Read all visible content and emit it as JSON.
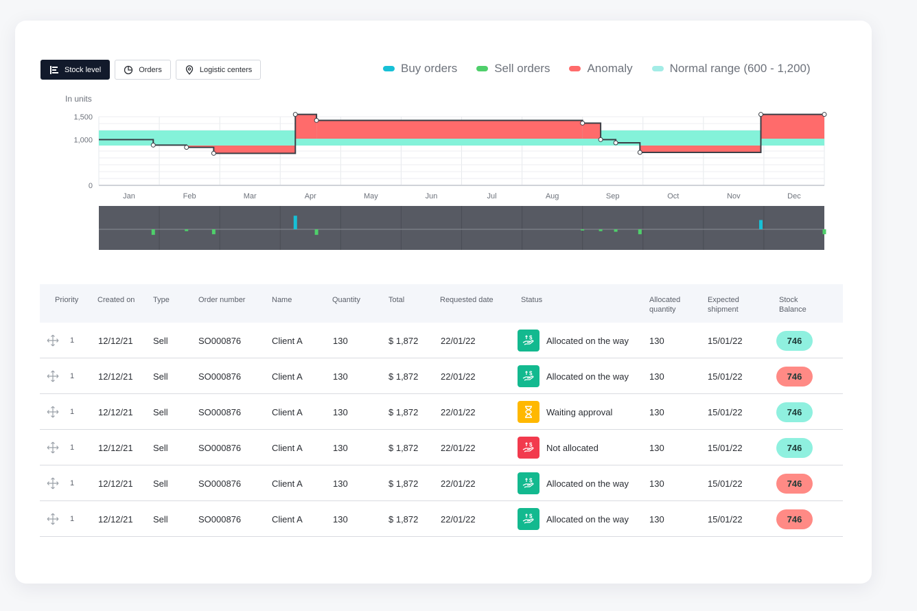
{
  "tabs": [
    {
      "label": "Stock level",
      "icon": "bar-list-icon",
      "active": true
    },
    {
      "label": "Orders",
      "icon": "pie-chart-icon",
      "active": false
    },
    {
      "label": "Logistic centers",
      "icon": "location-pin-icon",
      "active": false
    }
  ],
  "legend": [
    {
      "label": "Buy orders",
      "color": "#17c0d6"
    },
    {
      "label": "Sell orders",
      "color": "#4fcf6b"
    },
    {
      "label": "Anomaly",
      "color": "#ff6b6b"
    },
    {
      "label": "Normal range (600 - 1,200)",
      "color": "#a3ece6"
    }
  ],
  "units_label": "In units",
  "colors": {
    "normal_band": "#84f2d9",
    "anomaly": "#ff6b6b",
    "stock_line": "#3b3f46",
    "orders_panel": "#575a63",
    "buy": "#17c0d6",
    "sell": "#4fcf6b"
  },
  "chart_data": {
    "type": "line",
    "title": "",
    "ylabel": "In units",
    "yticks": [
      "1,500",
      "1,000",
      "0"
    ],
    "ylim": [
      0,
      1500
    ],
    "normal_range": [
      600,
      1200
    ],
    "months": [
      "Jan",
      "Feb",
      "Mar",
      "Apr",
      "May",
      "Jun",
      "Jul",
      "Aug",
      "Sep",
      "Oct",
      "Nov",
      "Dec"
    ],
    "stock_level_steps": [
      {
        "x": 0.0,
        "y": 1000
      },
      {
        "x": 0.9,
        "y": 880
      },
      {
        "x": 1.45,
        "y": 830
      },
      {
        "x": 1.9,
        "y": 700
      },
      {
        "x": 3.25,
        "y": 1550
      },
      {
        "x": 3.6,
        "y": 1420
      },
      {
        "x": 8.0,
        "y": 1360
      },
      {
        "x": 8.3,
        "y": 1000
      },
      {
        "x": 8.55,
        "y": 930
      },
      {
        "x": 8.95,
        "y": 720
      },
      {
        "x": 10.95,
        "y": 1550
      },
      {
        "x": 12.0,
        "y": 1550
      }
    ],
    "buy_orders": [
      {
        "x": 3.25,
        "value": 220
      },
      {
        "x": 10.95,
        "value": 150
      }
    ],
    "sell_orders": [
      {
        "x": 0.9,
        "value": 90
      },
      {
        "x": 1.45,
        "value": 30
      },
      {
        "x": 1.9,
        "value": 80
      },
      {
        "x": 3.6,
        "value": 90
      },
      {
        "x": 8.0,
        "value": 20
      },
      {
        "x": 8.3,
        "value": 30
      },
      {
        "x": 8.55,
        "value": 40
      },
      {
        "x": 8.95,
        "value": 80
      },
      {
        "x": 12.0,
        "value": 80
      }
    ]
  },
  "table": {
    "headers": {
      "priority": "Priority",
      "created_on": "Created on",
      "type": "Type",
      "order_number": "Order number",
      "name": "Name",
      "quantity": "Quantity",
      "total": "Total",
      "requested_date": "Requested date",
      "status": "Status",
      "allocated_quantity_1": "Allocated",
      "allocated_quantity_2": "quantity",
      "expected_shipment_1": "Expected",
      "expected_shipment_2": "shipment",
      "stock_balance_1": "Stock",
      "stock_balance_2": "Balance"
    },
    "rows": [
      {
        "priority": "1",
        "created_on": "12/12/21",
        "type": "Sell",
        "order_number": "SO000876",
        "name": "Client A",
        "quantity": "130",
        "total": "$ 1,872",
        "requested_date": "22/01/22",
        "status": "Allocated on the way",
        "status_kind": "allocated",
        "allocated_quantity": "130",
        "expected_shipment": "15/01/22",
        "stock_balance": "746",
        "balance_kind": "ok"
      },
      {
        "priority": "1",
        "created_on": "12/12/21",
        "type": "Sell",
        "order_number": "SO000876",
        "name": "Client A",
        "quantity": "130",
        "total": "$ 1,872",
        "requested_date": "22/01/22",
        "status": "Allocated on the way",
        "status_kind": "allocated",
        "allocated_quantity": "130",
        "expected_shipment": "15/01/22",
        "stock_balance": "746",
        "balance_kind": "alert"
      },
      {
        "priority": "1",
        "created_on": "12/12/21",
        "type": "Sell",
        "order_number": "SO000876",
        "name": "Client A",
        "quantity": "130",
        "total": "$ 1,872",
        "requested_date": "22/01/22",
        "status": "Waiting approval",
        "status_kind": "waiting",
        "allocated_quantity": "130",
        "expected_shipment": "15/01/22",
        "stock_balance": "746",
        "balance_kind": "ok"
      },
      {
        "priority": "1",
        "created_on": "12/12/21",
        "type": "Sell",
        "order_number": "SO000876",
        "name": "Client A",
        "quantity": "130",
        "total": "$ 1,872",
        "requested_date": "22/01/22",
        "status": "Not allocated",
        "status_kind": "not_allocated",
        "allocated_quantity": "130",
        "expected_shipment": "15/01/22",
        "stock_balance": "746",
        "balance_kind": "ok"
      },
      {
        "priority": "1",
        "created_on": "12/12/21",
        "type": "Sell",
        "order_number": "SO000876",
        "name": "Client A",
        "quantity": "130",
        "total": "$ 1,872",
        "requested_date": "22/01/22",
        "status": "Allocated on the way",
        "status_kind": "allocated",
        "allocated_quantity": "130",
        "expected_shipment": "15/01/22",
        "stock_balance": "746",
        "balance_kind": "alert"
      },
      {
        "priority": "1",
        "created_on": "12/12/21",
        "type": "Sell",
        "order_number": "SO000876",
        "name": "Client A",
        "quantity": "130",
        "total": "$ 1,872",
        "requested_date": "22/01/22",
        "status": "Allocated on the way",
        "status_kind": "allocated",
        "allocated_quantity": "130",
        "expected_shipment": "15/01/22",
        "stock_balance": "746",
        "balance_kind": "alert"
      }
    ],
    "status_colors": {
      "allocated": "#13b98f",
      "waiting": "#ffb800",
      "not_allocated": "#f23a4d"
    },
    "balance_colors": {
      "ok": "#8ff0df",
      "alert": "#ff8a85"
    }
  }
}
